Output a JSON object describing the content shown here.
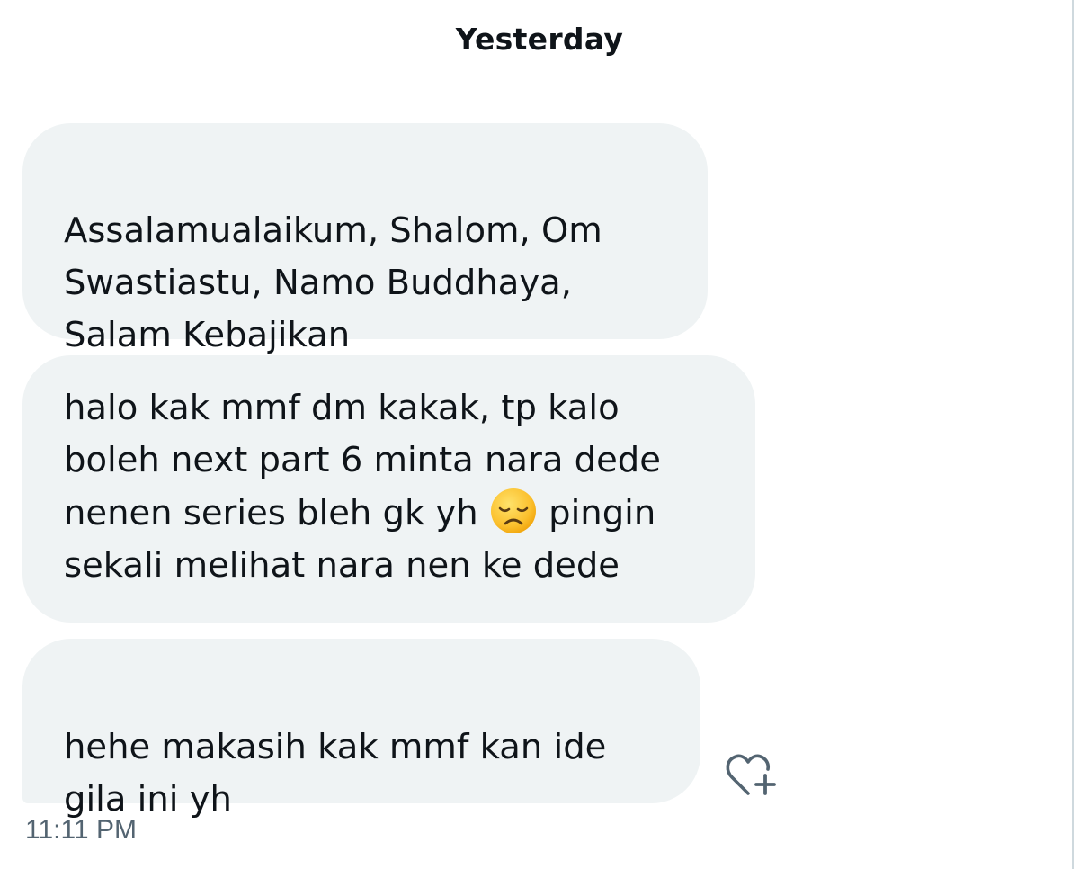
{
  "conversation": {
    "date_header": "Yesterday",
    "messages": [
      {
        "text": "Assalamualaikum, Shalom, Om\nSwastiastu, Namo Buddhaya,\nSalam Kebajikan"
      },
      {
        "text_before_emoji": "halo kak mmf dm kakak, tp kalo\nboleh next part 6 minta nara dede\nnenen series bleh gk yh ",
        "emoji": "disappointed-face-emoji",
        "text_after_emoji": " pingin\nsekali melihat nara nen ke dede"
      },
      {
        "text": "hehe makasih kak mmf kan ide\ngila ini yh"
      }
    ],
    "timestamp": "11:11 PM",
    "react_icon": "heart-plus-icon"
  },
  "colors": {
    "bubble_bg": "#eff3f4",
    "text": "#0f1419",
    "muted": "#536471",
    "rule": "#cfd9de"
  }
}
